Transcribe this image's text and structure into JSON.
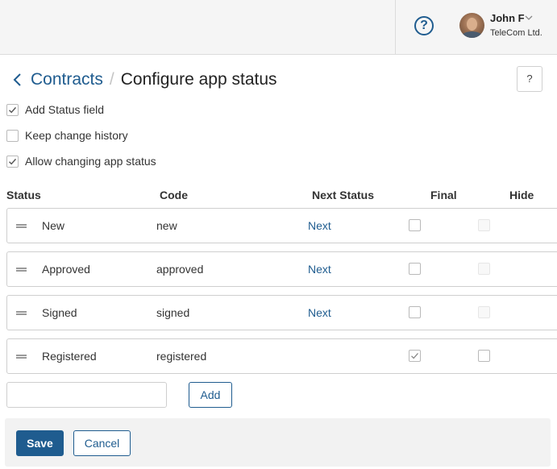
{
  "header": {
    "help_icon_glyph": "?",
    "user": {
      "name": "John F",
      "company": "TeleCom Ltd."
    }
  },
  "breadcrumb": {
    "parent": "Contracts",
    "separator": "/",
    "title": "Configure app status",
    "help_glyph": "?"
  },
  "options": [
    {
      "label": "Add Status field",
      "checked": true
    },
    {
      "label": "Keep change history",
      "checked": false
    },
    {
      "label": "Allow changing app status",
      "checked": true
    }
  ],
  "table": {
    "columns": [
      "Status",
      "Code",
      "Next Status",
      "Final",
      "Hide"
    ],
    "rows": [
      {
        "status": "New",
        "code": "new",
        "next": "Next",
        "final": false,
        "hide": false,
        "hide_enabled": false
      },
      {
        "status": "Approved",
        "code": "approved",
        "next": "Next",
        "final": false,
        "hide": false,
        "hide_enabled": false
      },
      {
        "status": "Signed",
        "code": "signed",
        "next": "Next",
        "final": false,
        "hide": false,
        "hide_enabled": false
      },
      {
        "status": "Registered",
        "code": "registered",
        "next": "",
        "final": true,
        "hide": false,
        "hide_enabled": true
      }
    ]
  },
  "new_status": {
    "value": "",
    "placeholder": "",
    "add_label": "Add"
  },
  "footer": {
    "save_label": "Save",
    "cancel_label": "Cancel"
  },
  "colors": {
    "accent": "#1f5c8f",
    "header_bg": "#f5f5f5",
    "footer_bg": "#f2f2f2"
  }
}
